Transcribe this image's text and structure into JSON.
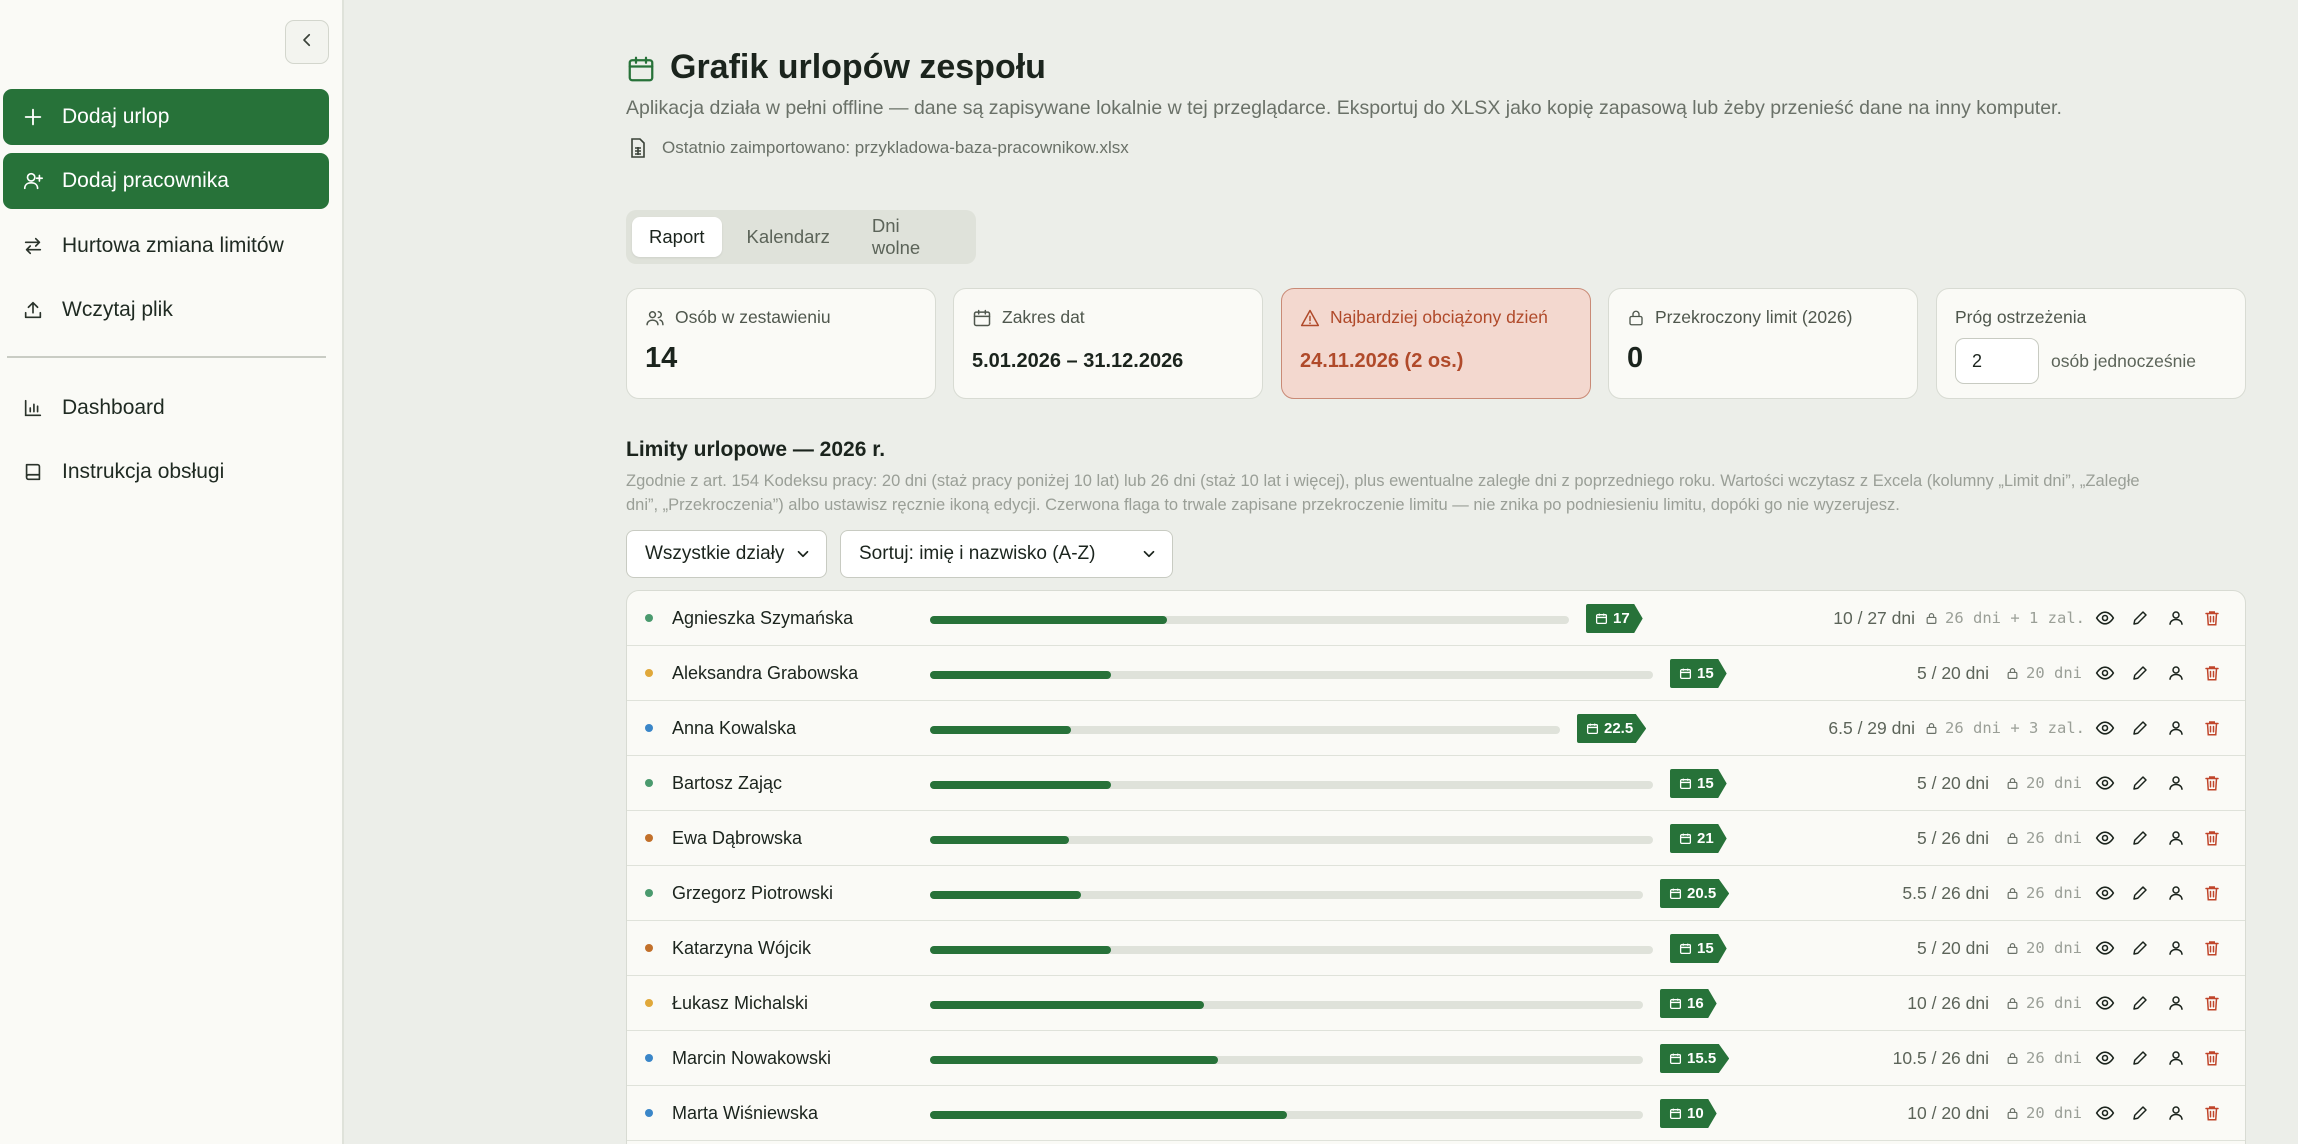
{
  "sidebar": {
    "items": [
      {
        "label": "Dodaj urlop",
        "icon": "plus-icon"
      },
      {
        "label": "Dodaj pracownika",
        "icon": "user-plus-icon"
      },
      {
        "label": "Hurtowa zmiana limitów",
        "icon": "arrows-exchange-icon"
      },
      {
        "label": "Wczytaj plik",
        "icon": "upload-icon"
      },
      {
        "label": "Dashboard",
        "icon": "bar-chart-icon"
      },
      {
        "label": "Instrukcja obsługi",
        "icon": "book-icon"
      }
    ]
  },
  "header": {
    "title": "Grafik urlopów zespołu",
    "subtitle": "Aplikacja działa w pełni offline — dane są zapisywane lokalnie w tej przeglądarce. Eksportuj do XLSX jako kopię zapasową lub żeby przenieść dane na inny komputer.",
    "import_label": "Ostatnio zaimportowano: przykladowa-baza-pracownikow.xlsx"
  },
  "tabs": [
    "Raport",
    "Kalendarz",
    "Dni wolne"
  ],
  "cards": {
    "people": {
      "label": "Osób w zestawieniu",
      "value": "14"
    },
    "range": {
      "label": "Zakres dat",
      "value": "5.01.2026 – 31.12.2026"
    },
    "busiest": {
      "label": "Najbardziej obciążony dzień",
      "value": "24.11.2026 (2 os.)"
    },
    "exceeded": {
      "label": "Przekroczony limit (2026)",
      "value": "0"
    },
    "threshold": {
      "label": "Próg ostrzeżenia",
      "value": "2",
      "suffix": "osób jednocześnie"
    }
  },
  "limits": {
    "title": "Limity urlopowe — 2026 r.",
    "note": "Zgodnie z art. 154 Kodeksu pracy: 20 dni (staż pracy poniżej 10 lat) lub 26 dni (staż 10 lat i więcej), plus ewentualne zaległe dni z poprzedniego roku. Wartości wczytasz z Excela (kolumny „Limit dni”, „Zaległe dni”, „Przekroczenia”) albo ustawisz ręcznie ikoną edycji. Czerwona flaga to trwale zapisane przekroczenie limitu — nie znika po podniesieniu limitu, dopóki go nie wyzerujesz.",
    "department_filter": "Wszystkie działy",
    "sort": "Sortuj: imię i nazwisko (A-Z)"
  },
  "employees": [
    {
      "name": "Agnieszka Szymańska",
      "dot_color": "#4a9a6e",
      "used": 10,
      "total": 27,
      "remaining": "17",
      "usage": "10 / 27 dni",
      "limit": "26 dni + 1 zal."
    },
    {
      "name": "Aleksandra Grabowska",
      "dot_color": "#e0a83a",
      "used": 5,
      "total": 20,
      "remaining": "15",
      "usage": "5 / 20 dni",
      "limit": "20 dni"
    },
    {
      "name": "Anna Kowalska",
      "dot_color": "#3a86c8",
      "used": 6.5,
      "total": 29,
      "remaining": "22.5",
      "usage": "6.5 / 29 dni",
      "limit": "26 dni + 3 zal."
    },
    {
      "name": "Bartosz Zając",
      "dot_color": "#4a9a6e",
      "used": 5,
      "total": 20,
      "remaining": "15",
      "usage": "5 / 20 dni",
      "limit": "20 dni"
    },
    {
      "name": "Ewa Dąbrowska",
      "dot_color": "#c2702a",
      "used": 5,
      "total": 26,
      "remaining": "21",
      "usage": "5 / 26 dni",
      "limit": "26 dni"
    },
    {
      "name": "Grzegorz Piotrowski",
      "dot_color": "#4a9a6e",
      "used": 5.5,
      "total": 26,
      "remaining": "20.5",
      "usage": "5.5 / 26 dni",
      "limit": "26 dni"
    },
    {
      "name": "Katarzyna Wójcik",
      "dot_color": "#c2702a",
      "used": 5,
      "total": 20,
      "remaining": "15",
      "usage": "5 / 20 dni",
      "limit": "20 dni"
    },
    {
      "name": "Łukasz Michalski",
      "dot_color": "#e0a83a",
      "used": 10,
      "total": 26,
      "remaining": "16",
      "usage": "10 / 26 dni",
      "limit": "26 dni"
    },
    {
      "name": "Marcin Nowakowski",
      "dot_color": "#3a86c8",
      "used": 10.5,
      "total": 26,
      "remaining": "15.5",
      "usage": "10.5 / 26 dni",
      "limit": "26 dni"
    },
    {
      "name": "Marta Wiśniewska",
      "dot_color": "#3a86c8",
      "used": 10,
      "total": 20,
      "remaining": "10",
      "usage": "10 / 20 dni",
      "limit": "20 dni"
    }
  ],
  "colors": {
    "accent": "#277239",
    "warn": "#b04a2a",
    "delete": "#c0452a"
  }
}
